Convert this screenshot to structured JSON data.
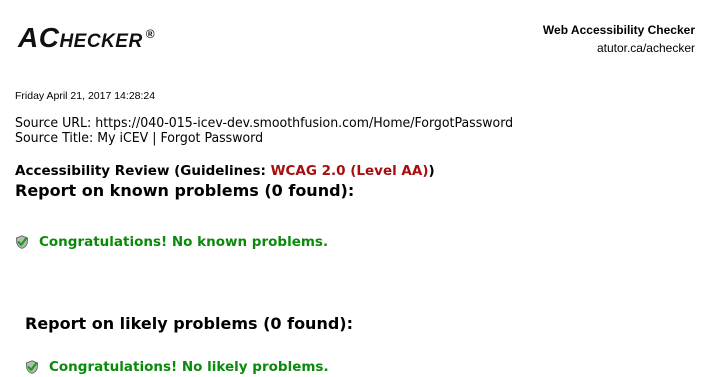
{
  "header": {
    "logo_first": "AC",
    "logo_rest": "HECKER",
    "logo_mark": "®",
    "title": "Web Accessibility Checker",
    "url": "atutor.ca/achecker"
  },
  "report": {
    "timestamp": "Friday April 21, 2017 14:28:24",
    "source_url": "Source URL: https://040-015-icev-dev.smoothfusion.com/Home/ForgotPassword",
    "source_title": "Source Title: My iCEV | Forgot Password",
    "review_prefix": "Accessibility Review (Guidelines: ",
    "guideline": "WCAG 2.0 (Level AA)",
    "review_suffix": ")",
    "known_heading": "Report on known problems (0 found):",
    "known_message": "Congratulations! No known problems.",
    "likely_heading": "Report on likely problems (0 found):",
    "likely_message": "Congratulations! No likely problems."
  },
  "icons": {
    "check": "checkmark-shield-icon"
  },
  "colors": {
    "guideline": "#a50e0e",
    "success": "#0a8a0a"
  }
}
